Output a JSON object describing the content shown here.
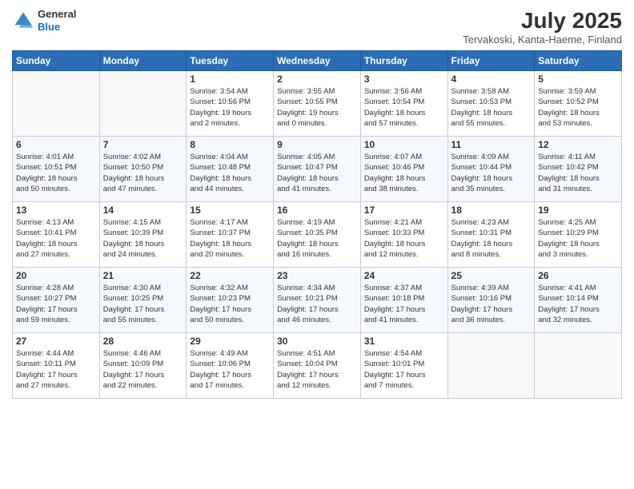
{
  "logo": {
    "general": "General",
    "blue": "Blue"
  },
  "header": {
    "title": "July 2025",
    "location": "Tervakoski, Kanta-Haeme, Finland"
  },
  "weekdays": [
    "Sunday",
    "Monday",
    "Tuesday",
    "Wednesday",
    "Thursday",
    "Friday",
    "Saturday"
  ],
  "weeks": [
    [
      {
        "day": "",
        "detail": ""
      },
      {
        "day": "",
        "detail": ""
      },
      {
        "day": "1",
        "detail": "Sunrise: 3:54 AM\nSunset: 10:56 PM\nDaylight: 19 hours\nand 2 minutes."
      },
      {
        "day": "2",
        "detail": "Sunrise: 3:55 AM\nSunset: 10:55 PM\nDaylight: 19 hours\nand 0 minutes."
      },
      {
        "day": "3",
        "detail": "Sunrise: 3:56 AM\nSunset: 10:54 PM\nDaylight: 18 hours\nand 57 minutes."
      },
      {
        "day": "4",
        "detail": "Sunrise: 3:58 AM\nSunset: 10:53 PM\nDaylight: 18 hours\nand 55 minutes."
      },
      {
        "day": "5",
        "detail": "Sunrise: 3:59 AM\nSunset: 10:52 PM\nDaylight: 18 hours\nand 53 minutes."
      }
    ],
    [
      {
        "day": "6",
        "detail": "Sunrise: 4:01 AM\nSunset: 10:51 PM\nDaylight: 18 hours\nand 50 minutes."
      },
      {
        "day": "7",
        "detail": "Sunrise: 4:02 AM\nSunset: 10:50 PM\nDaylight: 18 hours\nand 47 minutes."
      },
      {
        "day": "8",
        "detail": "Sunrise: 4:04 AM\nSunset: 10:48 PM\nDaylight: 18 hours\nand 44 minutes."
      },
      {
        "day": "9",
        "detail": "Sunrise: 4:05 AM\nSunset: 10:47 PM\nDaylight: 18 hours\nand 41 minutes."
      },
      {
        "day": "10",
        "detail": "Sunrise: 4:07 AM\nSunset: 10:46 PM\nDaylight: 18 hours\nand 38 minutes."
      },
      {
        "day": "11",
        "detail": "Sunrise: 4:09 AM\nSunset: 10:44 PM\nDaylight: 18 hours\nand 35 minutes."
      },
      {
        "day": "12",
        "detail": "Sunrise: 4:11 AM\nSunset: 10:42 PM\nDaylight: 18 hours\nand 31 minutes."
      }
    ],
    [
      {
        "day": "13",
        "detail": "Sunrise: 4:13 AM\nSunset: 10:41 PM\nDaylight: 18 hours\nand 27 minutes."
      },
      {
        "day": "14",
        "detail": "Sunrise: 4:15 AM\nSunset: 10:39 PM\nDaylight: 18 hours\nand 24 minutes."
      },
      {
        "day": "15",
        "detail": "Sunrise: 4:17 AM\nSunset: 10:37 PM\nDaylight: 18 hours\nand 20 minutes."
      },
      {
        "day": "16",
        "detail": "Sunrise: 4:19 AM\nSunset: 10:35 PM\nDaylight: 18 hours\nand 16 minutes."
      },
      {
        "day": "17",
        "detail": "Sunrise: 4:21 AM\nSunset: 10:33 PM\nDaylight: 18 hours\nand 12 minutes."
      },
      {
        "day": "18",
        "detail": "Sunrise: 4:23 AM\nSunset: 10:31 PM\nDaylight: 18 hours\nand 8 minutes."
      },
      {
        "day": "19",
        "detail": "Sunrise: 4:25 AM\nSunset: 10:29 PM\nDaylight: 18 hours\nand 3 minutes."
      }
    ],
    [
      {
        "day": "20",
        "detail": "Sunrise: 4:28 AM\nSunset: 10:27 PM\nDaylight: 17 hours\nand 59 minutes."
      },
      {
        "day": "21",
        "detail": "Sunrise: 4:30 AM\nSunset: 10:25 PM\nDaylight: 17 hours\nand 55 minutes."
      },
      {
        "day": "22",
        "detail": "Sunrise: 4:32 AM\nSunset: 10:23 PM\nDaylight: 17 hours\nand 50 minutes."
      },
      {
        "day": "23",
        "detail": "Sunrise: 4:34 AM\nSunset: 10:21 PM\nDaylight: 17 hours\nand 46 minutes."
      },
      {
        "day": "24",
        "detail": "Sunrise: 4:37 AM\nSunset: 10:18 PM\nDaylight: 17 hours\nand 41 minutes."
      },
      {
        "day": "25",
        "detail": "Sunrise: 4:39 AM\nSunset: 10:16 PM\nDaylight: 17 hours\nand 36 minutes."
      },
      {
        "day": "26",
        "detail": "Sunrise: 4:41 AM\nSunset: 10:14 PM\nDaylight: 17 hours\nand 32 minutes."
      }
    ],
    [
      {
        "day": "27",
        "detail": "Sunrise: 4:44 AM\nSunset: 10:11 PM\nDaylight: 17 hours\nand 27 minutes."
      },
      {
        "day": "28",
        "detail": "Sunrise: 4:46 AM\nSunset: 10:09 PM\nDaylight: 17 hours\nand 22 minutes."
      },
      {
        "day": "29",
        "detail": "Sunrise: 4:49 AM\nSunset: 10:06 PM\nDaylight: 17 hours\nand 17 minutes."
      },
      {
        "day": "30",
        "detail": "Sunrise: 4:51 AM\nSunset: 10:04 PM\nDaylight: 17 hours\nand 12 minutes."
      },
      {
        "day": "31",
        "detail": "Sunrise: 4:54 AM\nSunset: 10:01 PM\nDaylight: 17 hours\nand 7 minutes."
      },
      {
        "day": "",
        "detail": ""
      },
      {
        "day": "",
        "detail": ""
      }
    ]
  ]
}
